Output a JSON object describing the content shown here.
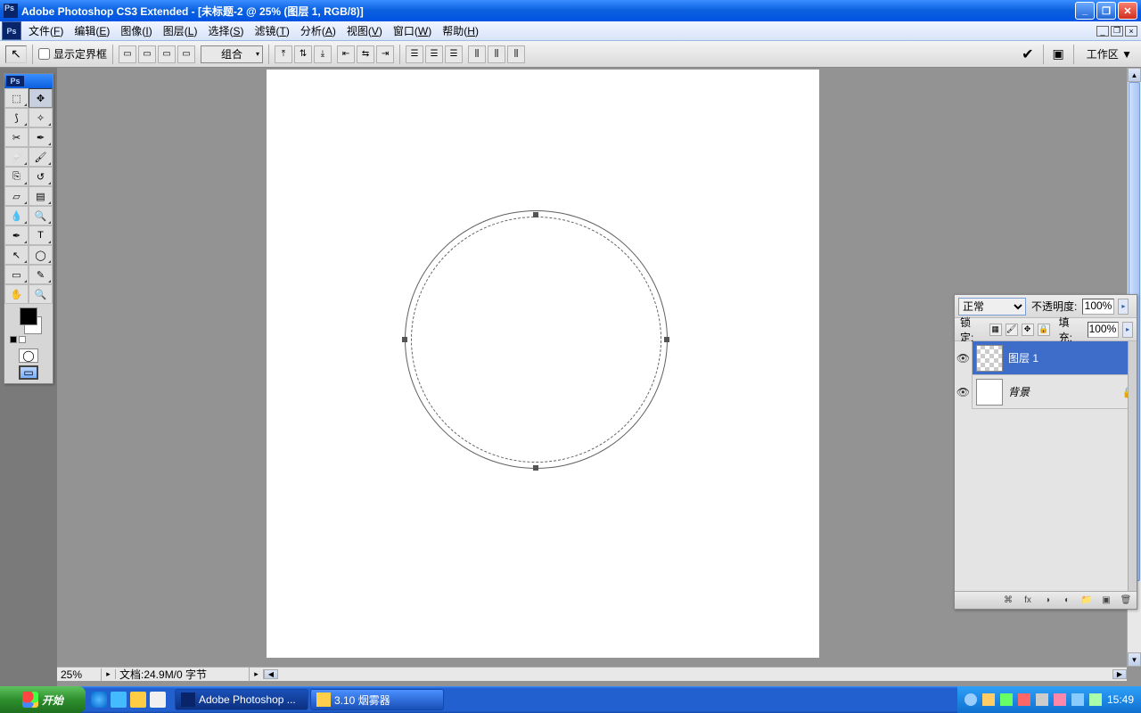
{
  "titlebar": {
    "title": "Adobe Photoshop CS3 Extended - [未标题-2 @ 25% (图层 1, RGB/8)]"
  },
  "menu": {
    "items": [
      {
        "label": "文件",
        "key": "F"
      },
      {
        "label": "编辑",
        "key": "E"
      },
      {
        "label": "图像",
        "key": "I"
      },
      {
        "label": "图层",
        "key": "L"
      },
      {
        "label": "选择",
        "key": "S"
      },
      {
        "label": "滤镜",
        "key": "T"
      },
      {
        "label": "分析",
        "key": "A"
      },
      {
        "label": "视图",
        "key": "V"
      },
      {
        "label": "窗口",
        "key": "W"
      },
      {
        "label": "帮助",
        "key": "H"
      }
    ]
  },
  "options": {
    "show_bounds_label": "显示定界框",
    "group_label": "组合",
    "workspace_label": "工作区 ▼"
  },
  "document": {
    "zoom": "25%",
    "info": "文档:24.9M/0 字节"
  },
  "layers_panel": {
    "blend_mode": "正常",
    "opacity_label": "不透明度:",
    "opacity_value": "100%",
    "lock_label": "锁定:",
    "fill_label": "填充:",
    "fill_value": "100%",
    "layers": [
      {
        "name": "图层 1",
        "selected": true,
        "locked": false,
        "bg": false
      },
      {
        "name": "背景",
        "selected": false,
        "locked": true,
        "bg": true
      }
    ]
  },
  "taskbar": {
    "start": "开始",
    "tasks": [
      {
        "label": "Adobe Photoshop ...",
        "active": true,
        "icon": "ps"
      },
      {
        "label": "3.10 烟雾器",
        "active": false,
        "icon": "folder"
      }
    ],
    "clock": "15:49"
  }
}
